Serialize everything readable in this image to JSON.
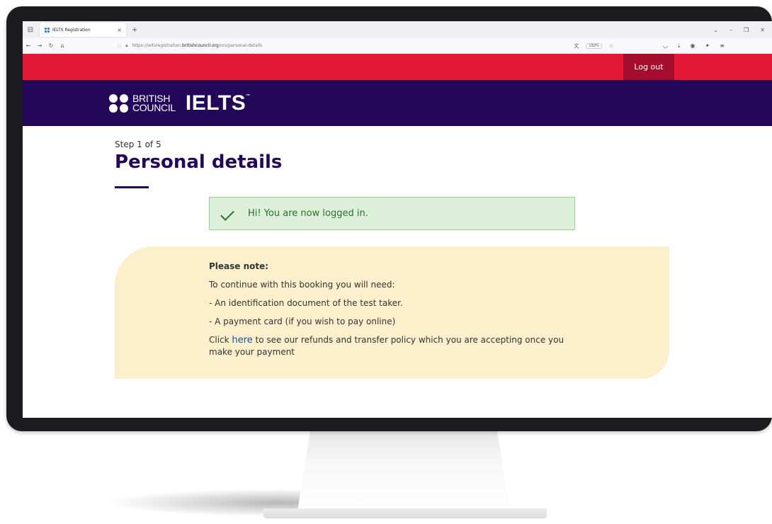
{
  "browser": {
    "tab_title": "IELTS Registration",
    "tab_close": "×",
    "new_tab": "+",
    "url_prefix": "https://ieltsregistration.",
    "url_domain": "britishcouncil.org",
    "url_path": "/ors/personal-details",
    "zoom": "150%"
  },
  "header": {
    "logout_label": "Log out",
    "brand_line1": "BRITISH",
    "brand_line2": "COUNCIL",
    "product": "IELTS",
    "tm": "™"
  },
  "main": {
    "step": "Step 1 of 5",
    "title": "Personal details",
    "alert": "Hi! You are now logged in.",
    "note": {
      "heading": "Please note:",
      "line1": "To continue with this booking you will need:",
      "line2": "- An identification document of the test taker.",
      "line3": "- A payment card (if you wish to pay online)",
      "policy_before": "Click ",
      "policy_link": "here",
      "policy_after": " to see our refunds and transfer policy which you are accepting once you make your payment"
    }
  },
  "colors": {
    "red_bar": "#e31837",
    "brand_purple": "#23085a",
    "alert_bg": "#dcefd9",
    "note_bg": "#fcefcc"
  }
}
